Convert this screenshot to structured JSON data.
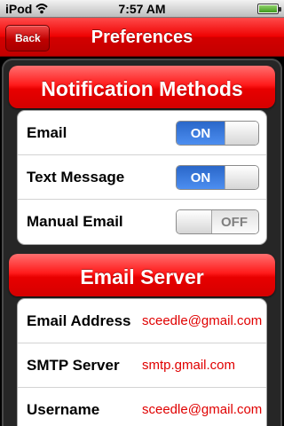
{
  "status_bar": {
    "carrier": "iPod",
    "time": "7:57 AM",
    "wifi_icon": "wifi-icon",
    "battery_icon": "battery-icon",
    "battery_level": 1.0
  },
  "nav": {
    "back_label": "Back",
    "title": "Preferences",
    "accent_color": "#e00000"
  },
  "notification_methods": {
    "header": "Notification Methods",
    "rows": [
      {
        "label": "Email",
        "state_label": "ON",
        "on": true
      },
      {
        "label": "Text Message",
        "state_label": "ON",
        "on": true
      },
      {
        "label": "Manual Email",
        "state_label": "OFF",
        "on": false
      }
    ]
  },
  "email_server": {
    "header": "Email Server",
    "rows": [
      {
        "label": "Email Address",
        "value": "sceedle@gmail.com"
      },
      {
        "label": "SMTP Server",
        "value": "smtp.gmail.com"
      },
      {
        "label": "Username",
        "value": "sceedle@gmail.com"
      }
    ]
  },
  "colors": {
    "switch_on": "#2f6fd6",
    "value_text": "#e00000"
  }
}
